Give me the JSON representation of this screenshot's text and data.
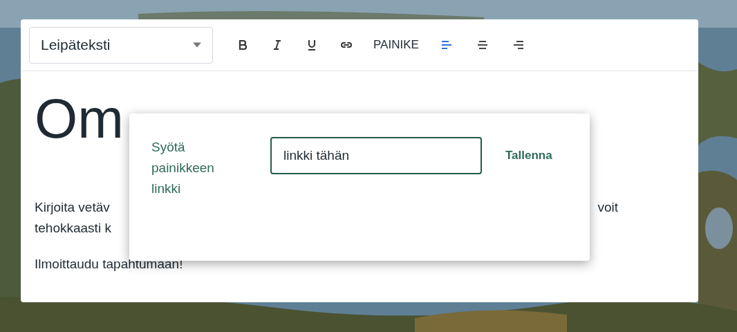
{
  "toolbar": {
    "style_select": {
      "value": "Leipäteksti"
    },
    "format_buttons": [
      {
        "kind": "bold"
      },
      {
        "kind": "italic"
      },
      {
        "kind": "underline"
      },
      {
        "kind": "link"
      }
    ],
    "button_tool": "PAINIKE",
    "align_buttons": [
      {
        "kind": "left",
        "selected": true
      },
      {
        "kind": "center",
        "selected": false
      },
      {
        "kind": "right",
        "selected": false
      }
    ]
  },
  "content": {
    "heading": "Om",
    "paragraph_lines": [
      {
        "left": "Kirjoita vetäv",
        "right": "voit"
      },
      {
        "left": "tehokkaasti k"
      }
    ],
    "last_paragraph": "Ilmoittaudu tapahtumaan!"
  },
  "link_popup": {
    "label": "Syötä painikkeen linkki",
    "input": {
      "value": "linkki tähän"
    },
    "save_button": "Tallenna"
  }
}
